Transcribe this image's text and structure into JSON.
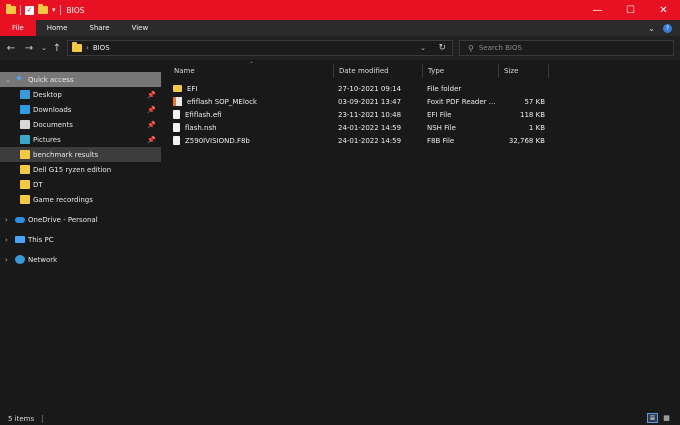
{
  "window": {
    "title": "BIOS",
    "colors": {
      "titlebar": "#e81123",
      "accent": "#4aa3ff",
      "folder": "#f6c945"
    }
  },
  "ribbon": {
    "tabs": [
      "File",
      "Home",
      "Share",
      "View"
    ]
  },
  "address": {
    "path": "BIOS"
  },
  "search": {
    "placeholder": "Search BIOS"
  },
  "nav": {
    "quick_access": "Quick access",
    "items": [
      {
        "label": "Desktop",
        "icon": "desktop-icon",
        "pinned": true
      },
      {
        "label": "Downloads",
        "icon": "download-icon",
        "pinned": true
      },
      {
        "label": "Documents",
        "icon": "documents-icon",
        "pinned": true
      },
      {
        "label": "Pictures",
        "icon": "pictures-icon",
        "pinned": true
      },
      {
        "label": "benchmark results",
        "icon": "folder-icon",
        "pinned": false
      },
      {
        "label": "Dell G15 ryzen edition",
        "icon": "folder-icon",
        "pinned": false
      },
      {
        "label": "DT",
        "icon": "folder-icon",
        "pinned": false
      },
      {
        "label": "Game recordings",
        "icon": "folder-icon",
        "pinned": false
      }
    ],
    "onedrive": "OneDrive - Personal",
    "this_pc": "This PC",
    "network": "Network"
  },
  "columns": {
    "name": "Name",
    "date": "Date modified",
    "type": "Type",
    "size": "Size"
  },
  "files": [
    {
      "name": "EFI",
      "date": "27-10-2021 09:14",
      "type": "File folder",
      "size": "",
      "icon": "folder-icon"
    },
    {
      "name": "efiflash SOP_MElock",
      "date": "03-09-2021 13:47",
      "type": "Foxit PDF Reader ...",
      "size": "57 KB",
      "icon": "pdf-icon"
    },
    {
      "name": "Efiflash.efi",
      "date": "23-11-2021 10:48",
      "type": "EFI File",
      "size": "118 KB",
      "icon": "file-icon"
    },
    {
      "name": "flash.nsh",
      "date": "24-01-2022 14:59",
      "type": "NSH File",
      "size": "1 KB",
      "icon": "file-icon"
    },
    {
      "name": "Z590IVISIOND.F8b",
      "date": "24-01-2022 14:59",
      "type": "F8B File",
      "size": "32,768 KB",
      "icon": "file-icon"
    }
  ],
  "status": {
    "item_count": "5 items"
  }
}
